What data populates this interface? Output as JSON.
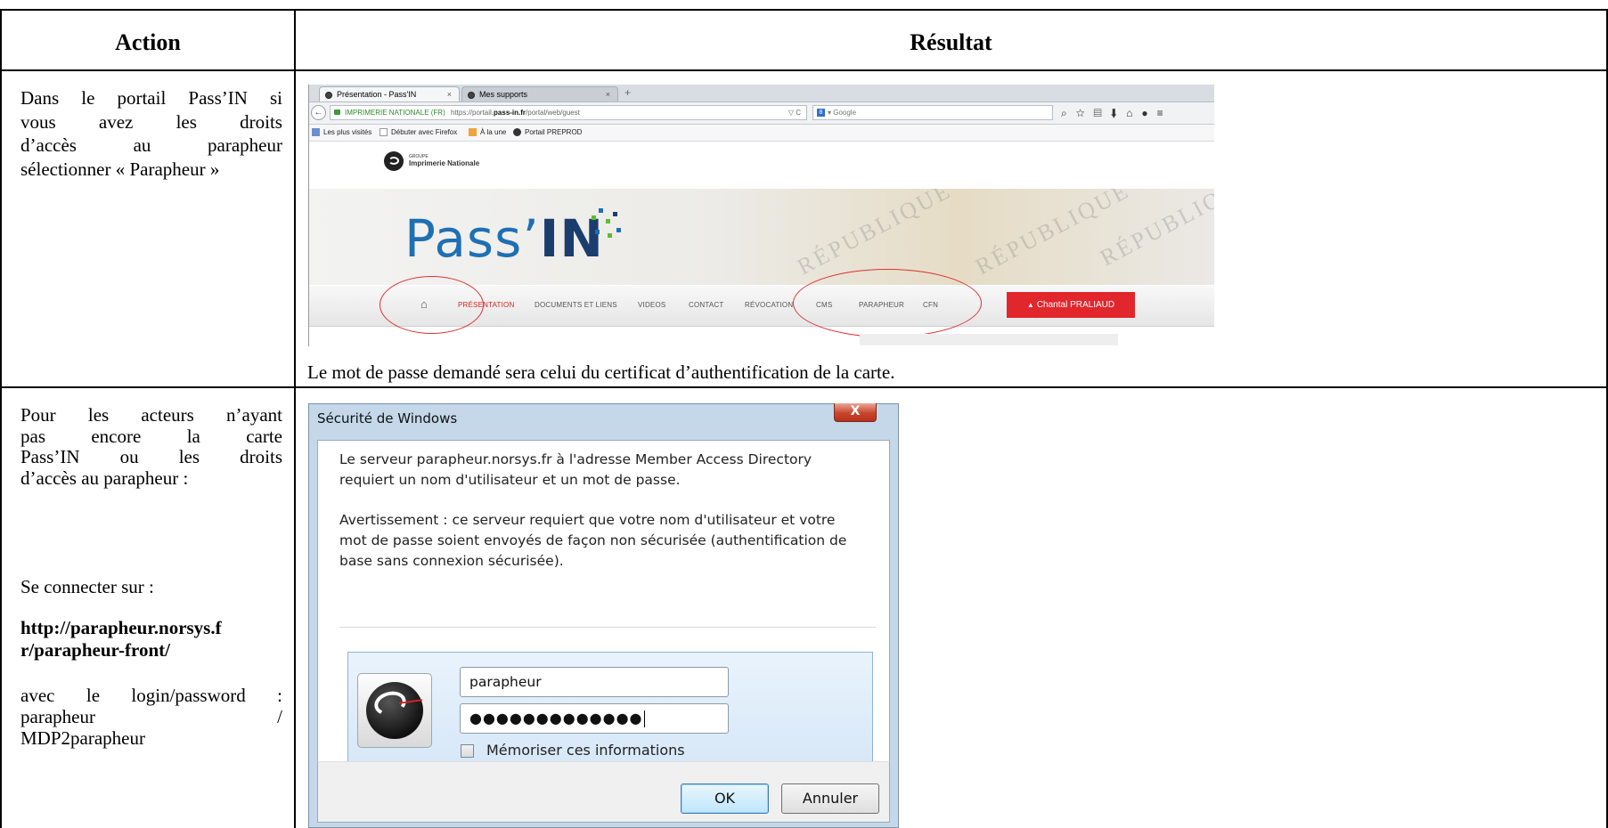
{
  "table": {
    "header_action": "Action",
    "header_result": "Résultat",
    "row1": {
      "action_lines": [
        [
          "Dans",
          "le",
          "portail",
          "Pass’IN",
          "si"
        ],
        [
          "vous",
          "avez",
          "les",
          "droits"
        ],
        [
          "d’accès",
          "au",
          "parapheur",
          ":"
        ]
      ],
      "action_last": "sélectionner « Parapheur »",
      "result_caption": "Le mot de passe demandé sera celui du certificat d’authentification de la carte."
    },
    "row2": {
      "intro_lines": [
        [
          "Pour",
          "les",
          "acteurs",
          "n’ayant"
        ],
        [
          "pas",
          "encore",
          "la",
          "carte"
        ],
        [
          "Pass’IN",
          "ou",
          "les",
          "droits"
        ]
      ],
      "intro_last": "d’accès au parapheur :",
      "connect": "Se connecter sur :",
      "url_line1": "http://parapheur.norsys.f",
      "url_line2": "r/parapheur-front/",
      "login_line1": [
        "avec",
        "le",
        "login/password",
        ":"
      ],
      "login_line2": [
        "parapheur",
        "/"
      ],
      "login_line3": "MDP2parapheur"
    }
  },
  "browser": {
    "tabs": [
      {
        "label": "Présentation - Pass'IN",
        "close": "×"
      },
      {
        "label": "Mes supports",
        "close": "×"
      }
    ],
    "new_tab": "+",
    "back": "←",
    "site_identity": "IMPRIMERIE NATIONALE (FR)",
    "url_prefix": "https://portail.",
    "url_domain": "pass-in.fr",
    "url_rest": "/portal/web/guest",
    "url_tail": "▽ C",
    "search_engine": "8",
    "search_placeholder": "▾ Google",
    "toolbar_icons": "⌕☆▤⬇⌂●≡",
    "bookmarks": [
      "Les plus visités",
      "Débuter avec Firefox",
      "À la une",
      "Portail PREPROD"
    ],
    "brand_small": "GROUPE",
    "brand": "Imprimerie Nationale",
    "hero_title_light": "Pass’",
    "hero_title_bold": "IN",
    "watermarks": [
      "RÉPUBLIQUE",
      "RÉPUBLIQUE",
      "RÉPUBLIQUE"
    ],
    "menu": [
      "PRÉSENTATION",
      "DOCUMENTS ET LIENS",
      "VIDEOS",
      "CONTACT",
      "RÉVOCATION",
      "CMS",
      "PARAPHEUR",
      "CFN"
    ],
    "home_icon": "⌂",
    "user_button": "Chantal PRALIAUD",
    "user_icon": "▲",
    "colors": {
      "brand_blue": "#1f6fb3",
      "menu_active": "#dd2222",
      "user_button": "#e1262c",
      "highlight_ring": "#dd3333"
    }
  },
  "dialog": {
    "title": "Sécurité de Windows",
    "close": "X",
    "message_lines": [
      "Le serveur parapheur.norsys.fr à l'adresse Member Access Directory",
      "requiert un nom d'utilisateur et un mot de passe."
    ],
    "warning_lines": [
      "Avertissement : ce serveur requiert que votre nom d'utilisateur et votre",
      "mot de passe soient envoyés de façon non sécurisée (authentification de",
      "base sans connexion sécurisée)."
    ],
    "username": "parapheur",
    "password_mask": "●●●●●●●●●●●●●",
    "remember_label": "Mémoriser ces informations",
    "ok_label": "OK",
    "cancel_label": "Annuler"
  }
}
